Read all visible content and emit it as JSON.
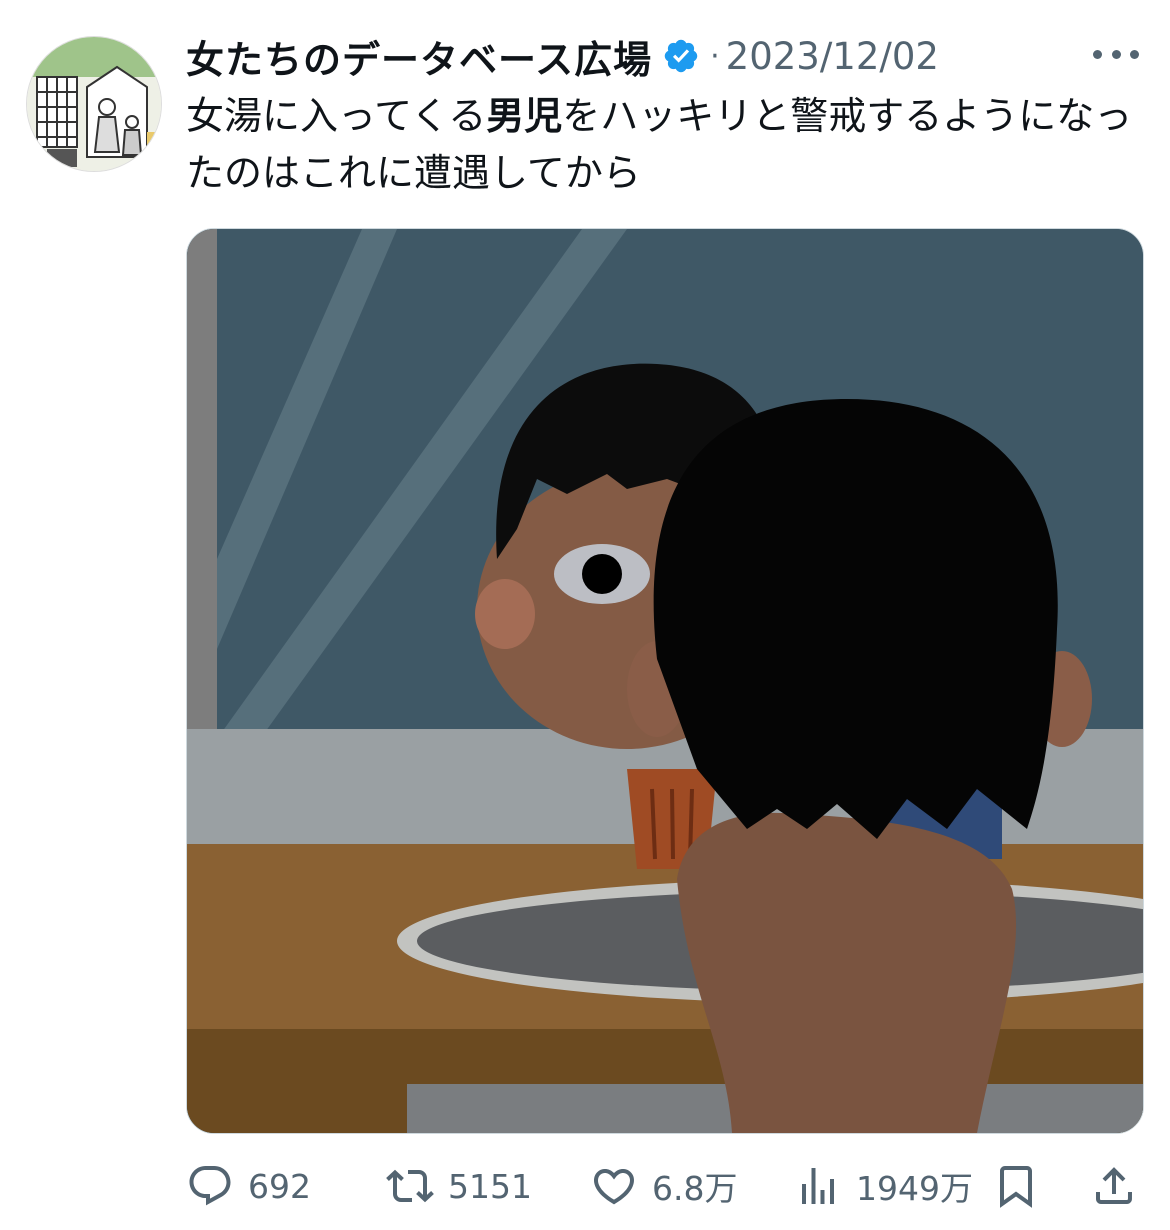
{
  "tweet": {
    "author_name": "女たちのデータベース広場",
    "separator": "·",
    "date": "2023/12/02",
    "text_part1": "女湯に入ってくる",
    "text_bold": "男児",
    "text_part2": "をハッキリと警戒するようになったのはこれに遭遇してから"
  },
  "actions": {
    "replies": "692",
    "retweets": "5151",
    "likes": "6.8万",
    "views": "1949万"
  },
  "icons": {
    "verified": "verified-badge-icon",
    "more": "more-dots-icon",
    "reply": "reply-bubble-icon",
    "retweet": "retweet-icon",
    "like": "heart-icon",
    "views": "bar-chart-icon",
    "bookmark": "bookmark-icon",
    "share": "share-icon"
  },
  "colors": {
    "verified_blue": "#1d9bf0",
    "secondary_text": "#536471",
    "primary_text": "#0f1419"
  }
}
